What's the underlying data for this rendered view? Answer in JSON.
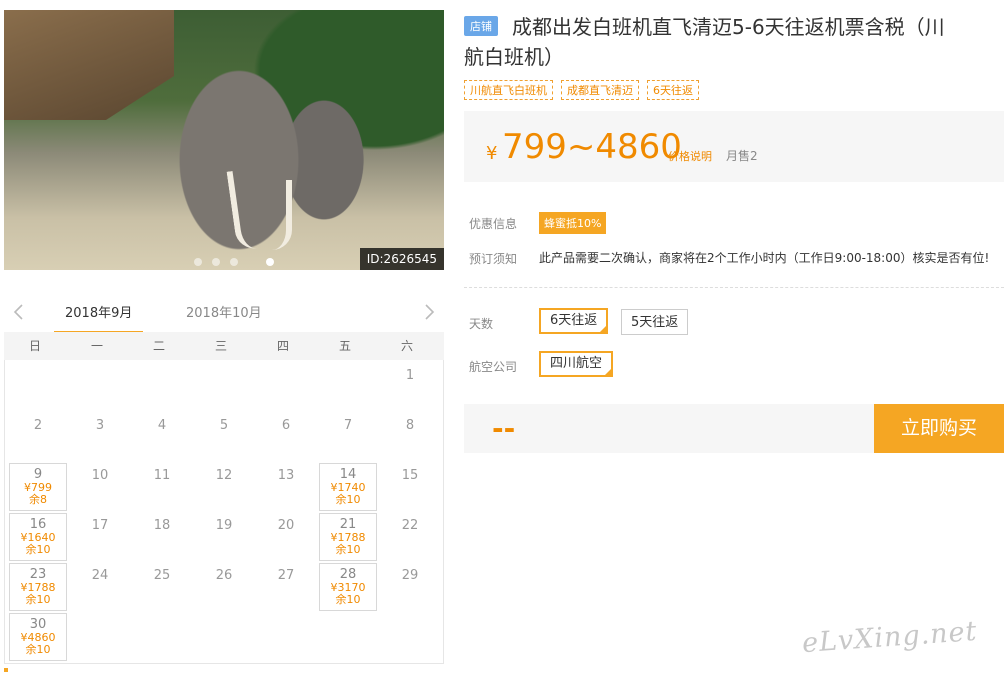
{
  "photo": {
    "id_label": "ID:2626545"
  },
  "header": {
    "shop_badge": "店铺",
    "title_line1": "成都出发白班机直飞清迈5-6天往返机票含税（川",
    "title_line2": "航白班机）",
    "tags": [
      "川航直飞白班机",
      "成都直飞清迈",
      "6天往返"
    ]
  },
  "price": {
    "currency": "¥",
    "range": "799~4860",
    "note": "价格说明",
    "sales": "月售2"
  },
  "info": {
    "discount_label": "优惠信息",
    "discount_value": "蜂蜜抵10%",
    "notice_label": "预订须知",
    "notice_text": "此产品需要二次确认，商家将在2个工作小时内（工作日9:00-18:00）核实是否有位!"
  },
  "options": {
    "days_label": "天数",
    "days": [
      "6天往返",
      "5天往返"
    ],
    "days_selected": "6天往返",
    "airline_label": "航空公司",
    "airlines": [
      "四川航空"
    ],
    "airline_selected": "四川航空"
  },
  "buy": {
    "amount": "--",
    "button": "立即购买"
  },
  "calendar": {
    "tabs": [
      "2018年9月",
      "2018年10月"
    ],
    "active_tab": "2018年9月",
    "weekdays": [
      "日",
      "一",
      "二",
      "三",
      "四",
      "五",
      "六"
    ],
    "days": [
      {
        "d": "1"
      },
      {
        "d": "2"
      },
      {
        "d": "3"
      },
      {
        "d": "4"
      },
      {
        "d": "5"
      },
      {
        "d": "6"
      },
      {
        "d": "7"
      },
      {
        "d": "8"
      },
      {
        "d": "9",
        "price": "¥799",
        "left": "余8"
      },
      {
        "d": "10"
      },
      {
        "d": "11"
      },
      {
        "d": "12"
      },
      {
        "d": "13"
      },
      {
        "d": "14",
        "price": "¥1740",
        "left": "余10"
      },
      {
        "d": "15"
      },
      {
        "d": "16",
        "price": "¥1640",
        "left": "余10"
      },
      {
        "d": "17"
      },
      {
        "d": "18"
      },
      {
        "d": "19"
      },
      {
        "d": "20"
      },
      {
        "d": "21",
        "price": "¥1788",
        "left": "余10"
      },
      {
        "d": "22"
      },
      {
        "d": "23",
        "price": "¥1788",
        "left": "余10"
      },
      {
        "d": "24"
      },
      {
        "d": "25"
      },
      {
        "d": "26"
      },
      {
        "d": "27"
      },
      {
        "d": "28",
        "price": "¥3170",
        "left": "余10"
      },
      {
        "d": "29"
      },
      {
        "d": "30",
        "price": "¥4860",
        "left": "余10"
      }
    ],
    "first_weekday": 6
  },
  "watermark": "eLvXing.net",
  "colors": {
    "accent": "#f5a623",
    "price": "#f08a00",
    "badge": "#6aa7e8"
  }
}
